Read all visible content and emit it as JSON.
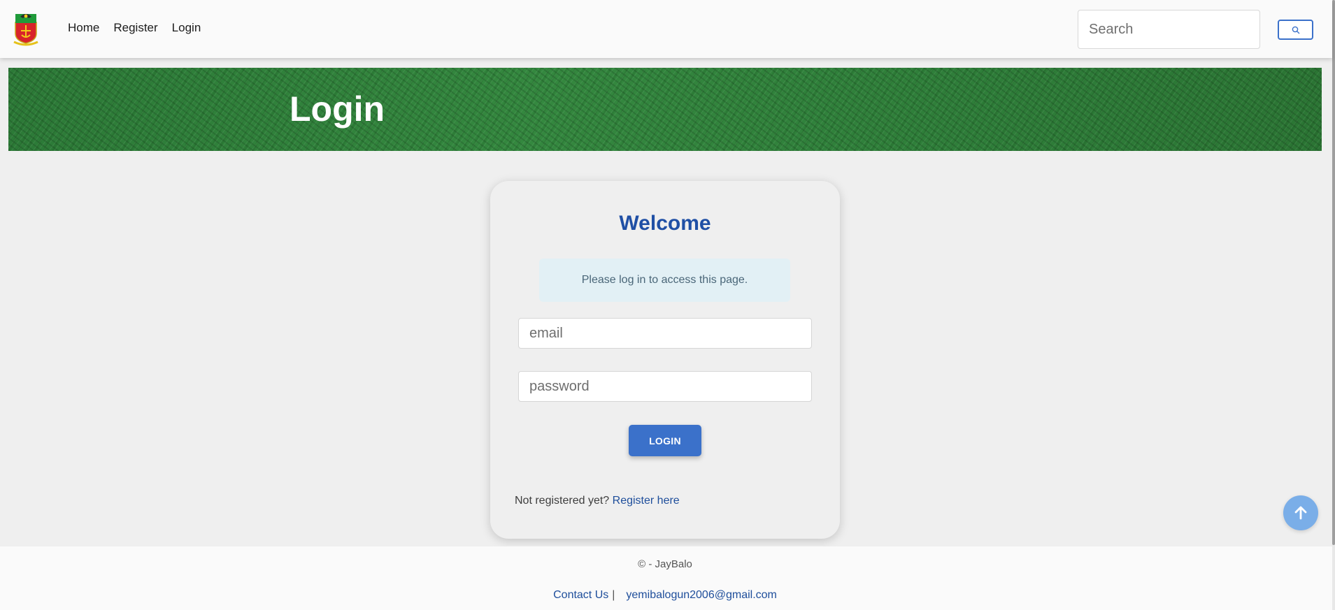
{
  "navbar": {
    "logo_icon": "coat-of-arms-icon",
    "links": [
      {
        "label": "Home"
      },
      {
        "label": "Register"
      },
      {
        "label": "Login"
      }
    ],
    "search": {
      "placeholder": "Search",
      "value": ""
    },
    "search_button_icon": "search-icon"
  },
  "hero": {
    "title": "Login"
  },
  "card": {
    "heading": "Welcome",
    "alert": "Please log in to access this page.",
    "email": {
      "placeholder": "email",
      "value": ""
    },
    "password": {
      "placeholder": "password",
      "value": ""
    },
    "login_label": "LOGIN",
    "register_prompt": "Not registered yet?",
    "register_link": "Register here"
  },
  "footer": {
    "copyright": "© - JayBalo",
    "contact_label": "Contact Us",
    "separator": "|",
    "email": "yemibalogun2006@gmail.com"
  },
  "back_to_top_icon": "arrow-up-icon",
  "colors": {
    "primary": "#3b71ca",
    "heading": "#1f4fa5",
    "link": "#1e4e9b",
    "alert_bg": "#e2f0f5",
    "hero_green": "#2e7d3a",
    "back_to_top": "#7aaee8"
  }
}
